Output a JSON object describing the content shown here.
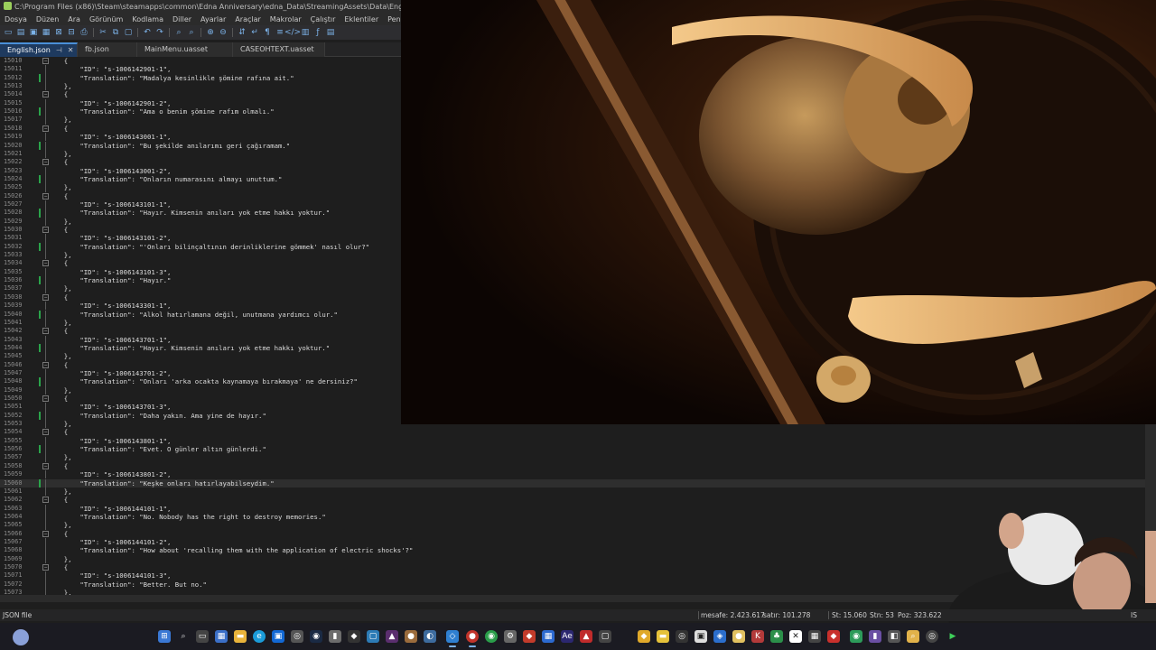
{
  "window": {
    "title": "C:\\Program Files (x86)\\Steam\\steamapps\\common\\Edna Anniversary\\edna_Data\\StreamingAssets\\Data\\English.json - Not"
  },
  "menu": [
    "Dosya",
    "Düzen",
    "Ara",
    "Görünüm",
    "Kodlama",
    "Diller",
    "Ayarlar",
    "Araçlar",
    "Makrolar",
    "Çalıştır",
    "Eklentiler",
    "Pencereler",
    "?"
  ],
  "tabs": [
    {
      "label": "English.json",
      "active": true
    },
    {
      "label": "fb.json",
      "active": false
    },
    {
      "label": "MainMenu.uasset",
      "active": false
    },
    {
      "label": "CASEOHTEXT.uasset",
      "active": false
    }
  ],
  "editor": {
    "current_line": "15060",
    "lines": [
      {
        "n": "15010",
        "t": "  {",
        "fold": "box",
        "ch": false
      },
      {
        "n": "15011",
        "t": "      \"ID\": \"s-1006142901-1\",",
        "ch": false
      },
      {
        "n": "15012",
        "t": "      \"Translation\": \"Madalya kesinlikle şömine rafına ait.\"",
        "ch": true
      },
      {
        "n": "15013",
        "t": "  },",
        "ch": false
      },
      {
        "n": "15014",
        "t": "  {",
        "fold": "box",
        "ch": false
      },
      {
        "n": "15015",
        "t": "      \"ID\": \"s-1006142901-2\",",
        "ch": false
      },
      {
        "n": "15016",
        "t": "      \"Translation\": \"Ama o benim şömine rafım olmalı.\"",
        "ch": true
      },
      {
        "n": "15017",
        "t": "  },",
        "ch": false
      },
      {
        "n": "15018",
        "t": "  {",
        "fold": "box",
        "ch": false
      },
      {
        "n": "15019",
        "t": "      \"ID\": \"s-1006143001-1\",",
        "ch": false
      },
      {
        "n": "15020",
        "t": "      \"Translation\": \"Bu şekilde anılarımı geri çağıramam.\"",
        "ch": true
      },
      {
        "n": "15021",
        "t": "  },",
        "ch": false
      },
      {
        "n": "15022",
        "t": "  {",
        "fold": "box",
        "ch": false
      },
      {
        "n": "15023",
        "t": "      \"ID\": \"s-1006143001-2\",",
        "ch": false
      },
      {
        "n": "15024",
        "t": "      \"Translation\": \"Onların numarasını almayı unuttum.\"",
        "ch": true
      },
      {
        "n": "15025",
        "t": "  },",
        "ch": false
      },
      {
        "n": "15026",
        "t": "  {",
        "fold": "box",
        "ch": false
      },
      {
        "n": "15027",
        "t": "      \"ID\": \"s-1006143101-1\",",
        "ch": false
      },
      {
        "n": "15028",
        "t": "      \"Translation\": \"Hayır. Kimsenin anıları yok etme hakkı yoktur.\"",
        "ch": true
      },
      {
        "n": "15029",
        "t": "  },",
        "ch": false
      },
      {
        "n": "15030",
        "t": "  {",
        "fold": "box",
        "ch": false
      },
      {
        "n": "15031",
        "t": "      \"ID\": \"s-1006143101-2\",",
        "ch": false
      },
      {
        "n": "15032",
        "t": "      \"Translation\": \"'Onları bilinçaltının derinliklerine gömmek' nasıl olur?\"",
        "ch": true
      },
      {
        "n": "15033",
        "t": "  },",
        "ch": false
      },
      {
        "n": "15034",
        "t": "  {",
        "fold": "box",
        "ch": false
      },
      {
        "n": "15035",
        "t": "      \"ID\": \"s-1006143101-3\",",
        "ch": false
      },
      {
        "n": "15036",
        "t": "      \"Translation\": \"Hayır.\"",
        "ch": true
      },
      {
        "n": "15037",
        "t": "  },",
        "ch": false
      },
      {
        "n": "15038",
        "t": "  {",
        "fold": "box",
        "ch": false
      },
      {
        "n": "15039",
        "t": "      \"ID\": \"s-1006143301-1\",",
        "ch": false
      },
      {
        "n": "15040",
        "t": "      \"Translation\": \"Alkol hatırlamana değil, unutmana yardımcı olur.\"",
        "ch": true
      },
      {
        "n": "15041",
        "t": "  },",
        "ch": false
      },
      {
        "n": "15042",
        "t": "  {",
        "fold": "box",
        "ch": false
      },
      {
        "n": "15043",
        "t": "      \"ID\": \"s-1006143701-1\",",
        "ch": false
      },
      {
        "n": "15044",
        "t": "      \"Translation\": \"Hayır. Kimsenin anıları yok etme hakkı yoktur.\"",
        "ch": true
      },
      {
        "n": "15045",
        "t": "  },",
        "ch": false
      },
      {
        "n": "15046",
        "t": "  {",
        "fold": "box",
        "ch": false
      },
      {
        "n": "15047",
        "t": "      \"ID\": \"s-1006143701-2\",",
        "ch": false
      },
      {
        "n": "15048",
        "t": "      \"Translation\": \"Onları 'arka ocakta kaynamaya bırakmaya' ne dersiniz?\"",
        "ch": true
      },
      {
        "n": "15049",
        "t": "  },",
        "ch": false
      },
      {
        "n": "15050",
        "t": "  {",
        "fold": "box",
        "ch": false
      },
      {
        "n": "15051",
        "t": "      \"ID\": \"s-1006143701-3\",",
        "ch": false
      },
      {
        "n": "15052",
        "t": "      \"Translation\": \"Daha yakın. Ama yine de hayır.\"",
        "ch": true
      },
      {
        "n": "15053",
        "t": "  },",
        "ch": false
      },
      {
        "n": "15054",
        "t": "  {",
        "fold": "box",
        "ch": false
      },
      {
        "n": "15055",
        "t": "      \"ID\": \"s-1006143801-1\",",
        "ch": false
      },
      {
        "n": "15056",
        "t": "      \"Translation\": \"Evet. O günler altın günlerdi.\"",
        "ch": true
      },
      {
        "n": "15057",
        "t": "  },",
        "ch": false
      },
      {
        "n": "15058",
        "t": "  {",
        "fold": "box",
        "ch": false
      },
      {
        "n": "15059",
        "t": "      \"ID\": \"s-1006143801-2\",",
        "ch": false
      },
      {
        "n": "15060",
        "t": "      \"Translation\": \"Keşke onları hatırlayabilseydim.\"",
        "ch": true
      },
      {
        "n": "15061",
        "t": "  },",
        "ch": false
      },
      {
        "n": "15062",
        "t": "  {",
        "fold": "box",
        "ch": false
      },
      {
        "n": "15063",
        "t": "      \"ID\": \"s-1006144101-1\",",
        "ch": false
      },
      {
        "n": "15064",
        "t": "      \"Translation\": \"No. Nobody has the right to destroy memories.\"",
        "ch": false
      },
      {
        "n": "15065",
        "t": "  },",
        "ch": false
      },
      {
        "n": "15066",
        "t": "  {",
        "fold": "box",
        "ch": false
      },
      {
        "n": "15067",
        "t": "      \"ID\": \"s-1006144101-2\",",
        "ch": false
      },
      {
        "n": "15068",
        "t": "      \"Translation\": \"How about 'recalling them with the application of electric shocks'?\"",
        "ch": false
      },
      {
        "n": "15069",
        "t": "  },",
        "ch": false
      },
      {
        "n": "15070",
        "t": "  {",
        "fold": "box",
        "ch": false
      },
      {
        "n": "15071",
        "t": "      \"ID\": \"s-1006144101-3\",",
        "ch": false
      },
      {
        "n": "15072",
        "t": "      \"Translation\": \"Better. But no.\"",
        "ch": false
      },
      {
        "n": "15073",
        "t": "  },",
        "ch": false
      }
    ]
  },
  "status": {
    "file_type": "JSON file",
    "distance": "mesafe: 2.423.617",
    "lines": "satır: 101.278",
    "line": "St: 15.060",
    "col": "Stn: 53",
    "pos": "Poz: 323.622",
    "extra": "IS"
  },
  "colors": {
    "accent": "#4a90d9",
    "change_marker": "#2aa44a",
    "editor_bg": "#1e1e1e"
  }
}
